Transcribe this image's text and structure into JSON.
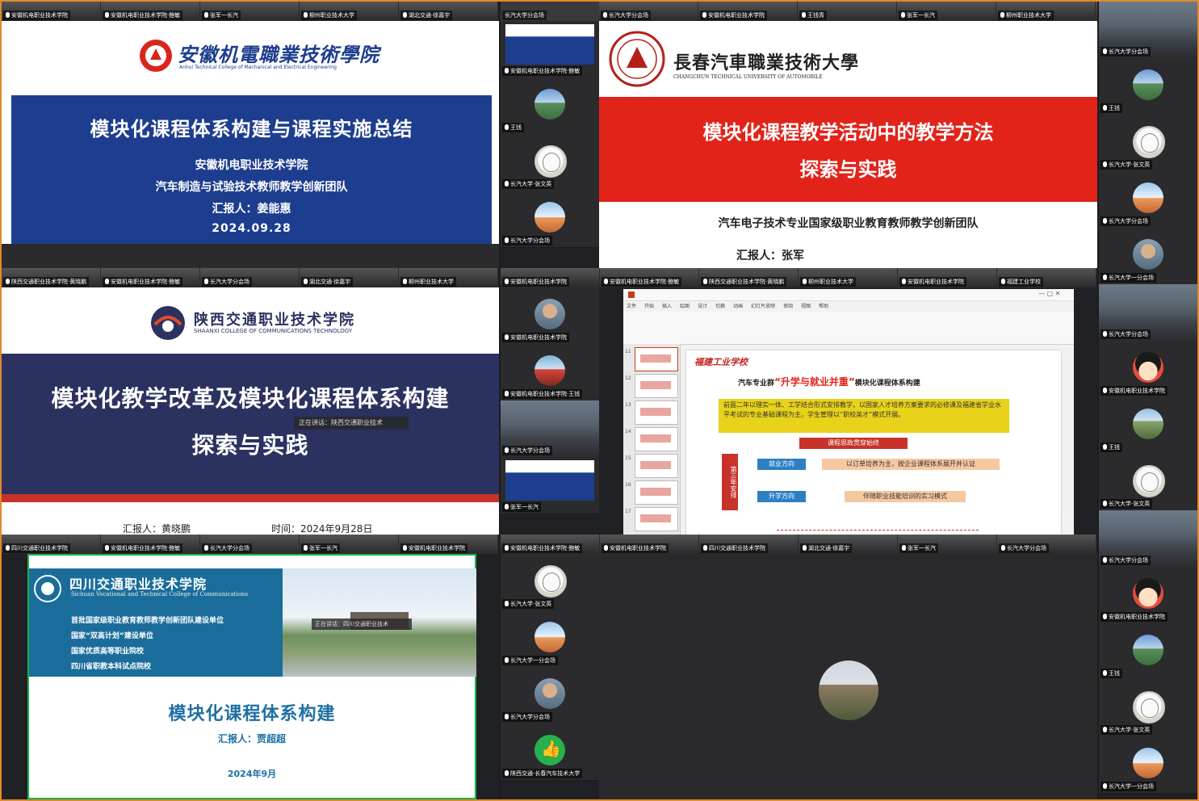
{
  "colors": {
    "frame_border": "#e08a2e",
    "meeting_bg": "#1d1d1f",
    "active_speaker": "#19b34a",
    "anhui_blue": "#1d3d8e",
    "changchun_red": "#e2231a",
    "shaanxi_navy": "#2b3260",
    "sichuan_blue": "#1a6d9b",
    "sichuan_title": "#1f6fa3"
  },
  "top_strip_1": [
    {
      "name": "安徽机电职业技术学院"
    },
    {
      "name": "安徽机电职业技术学院·鲍敏"
    },
    {
      "name": "张军一长汽"
    },
    {
      "name": "柳州职业技术大学"
    },
    {
      "name": "湖北交通·徐嘉宇"
    }
  ],
  "top_strip_2": [
    {
      "name": "长汽大学分会场"
    },
    {
      "name": "安徽机电职业技术学院"
    },
    {
      "name": "王钱青"
    },
    {
      "name": "张军一长汽"
    },
    {
      "name": "柳州职业技术大学"
    },
    {
      "name": "安徽机电职业技术学院"
    }
  ],
  "strip_row2_left": [
    {
      "name": "陕西交通职业技术学院·黄晓鹏"
    },
    {
      "name": "安徽机电职业技术学院·鲍敏"
    },
    {
      "name": "长汽大学分会场"
    },
    {
      "name": "湖北交通·徐嘉宇"
    },
    {
      "name": "柳州职业技术大学"
    }
  ],
  "strip_row2_right": [
    {
      "name": "安徽机电职业技术学院"
    },
    {
      "name": "安徽机电职业技术学院·鲍敏"
    },
    {
      "name": "陕西交通职业技术学院·黄晓鹏"
    },
    {
      "name": "柳州职业技术大学"
    },
    {
      "name": "安徽机电职业技术学院"
    },
    {
      "name": "福建工业学校"
    }
  ],
  "strip_row3_left": [
    {
      "name": "四川交通职业技术学院"
    },
    {
      "name": "安徽机电职业技术学院·鲍敏"
    },
    {
      "name": "长汽大学分会场"
    },
    {
      "name": "张军一长汽"
    },
    {
      "name": "安徽机电职业技术学院"
    }
  ],
  "strip_row3_right": [
    {
      "name": "安徽机电职业技术学院·鲍敏"
    },
    {
      "name": "安徽机电职业技术学院"
    },
    {
      "name": "四川交通职业技术学院"
    },
    {
      "name": "湖北交通·徐嘉宇"
    },
    {
      "name": "张军一长汽"
    },
    {
      "name": "长汽大学分会场"
    }
  ],
  "side_mid": [
    {
      "name": "安徽机电职业技术学院·鲍敏",
      "avatar": "slide"
    },
    {
      "name": "王钱",
      "avatar": "nature"
    },
    {
      "name": "长汽大学·张文英",
      "avatar": "sketch"
    },
    {
      "name": "长汽大学分会场",
      "avatar": "sky"
    },
    {
      "name": "安徽机电职业技术学院",
      "avatar": "person"
    },
    {
      "name": "安徽机电职业技术学院·王钱",
      "avatar": "red"
    },
    {
      "name": "长汽大学分会场",
      "avatar": "photo"
    },
    {
      "name": "张军一长汽",
      "avatar": "slide"
    },
    {
      "name": "安徽机电职业技术学院",
      "avatar": "cartoon"
    },
    {
      "name": "王钱",
      "avatar": "field"
    },
    {
      "name": "长汽大学·张文英",
      "avatar": "sketch"
    },
    {
      "name": "长汽大学一分会场",
      "avatar": "sky"
    },
    {
      "name": "长汽大学分会场",
      "avatar": "person"
    },
    {
      "name": "陕西交通·长春汽车技术大学",
      "avatar": "thumb"
    }
  ],
  "side_right": [
    {
      "name": "长汽大学分会场",
      "avatar": "photo"
    },
    {
      "name": "王钱",
      "avatar": "nature"
    },
    {
      "name": "长汽大学·张文英",
      "avatar": "sketch"
    },
    {
      "name": "长汽大学分会场",
      "avatar": "sky"
    },
    {
      "name": "长汽大学一分会场",
      "avatar": "person"
    },
    {
      "name": "长汽大学分会场",
      "avatar": "photo"
    },
    {
      "name": "安徽机电职业技术学院",
      "avatar": "cartoon"
    },
    {
      "name": "王钱",
      "avatar": "field"
    },
    {
      "name": "长汽大学·张文英",
      "avatar": "sketch"
    },
    {
      "name": "长汽大学分会场",
      "avatar": "photo"
    },
    {
      "name": "安徽机电职业技术学院",
      "avatar": "cartoon"
    },
    {
      "name": "王钱",
      "avatar": "nature"
    },
    {
      "name": "长汽大学·张文英",
      "avatar": "sketch"
    },
    {
      "name": "长汽大学一分会场",
      "avatar": "sky"
    }
  ],
  "anhui": {
    "school_cn": "安徽机電職業技術學院",
    "school_en": "Anhui Technical College of Mechanical and Electrical Engineering",
    "title": "模块化课程体系构建与课程实施总结",
    "line1": "安徽机电职业技术学院",
    "line2": "汽车制造与试验技术教师教学创新团队",
    "reporter": "汇报人：姜能惠",
    "date": "2024.09.28"
  },
  "changchun": {
    "school_cn": "長春汽車職業技術大學",
    "school_en": "CHANGCHUN TECHNICAL UNIVERSITY OF AUTOMOBILE",
    "title_line1": "模块化课程教学活动中的教学方法",
    "title_line2": "探索与实践",
    "team": "汽车电子技术专业国家级职业教育教师教学创新团队",
    "reporter": "汇报人：张军"
  },
  "shaanxi": {
    "school_cn": "陕西交通职业技术学院",
    "school_en": "SHAANXI COLLEGE OF COMMUNICATIONS TECHNOLOGY",
    "title_line1": "模块化教学改革及模块化课程体系构建",
    "title_line2": "探索与实践",
    "overlay": "正在讲话：陕西交通职业技术",
    "reporter": "汇报人：黄晓鹏",
    "time": "时间：2024年9月28日"
  },
  "fujian": {
    "brand": "福建工业学校",
    "heading_pre": "汽车专业群",
    "heading_highlight": "“升学与就业并重”",
    "heading_post": "模块化课程体系构建",
    "para": "前面二年以理实一体、工学结合形式安排教学，以国家人才培养方案要求的必修课及福建省学业水平考试的专业基础课程为主。学生管理以“职校英才”模式开展。",
    "thread": "课程思政贯穿始终",
    "vertical": "第三年安排",
    "path1": "就业方向",
    "desc1": "以订单培养为主，按企业课程体系展开并认证",
    "path2": "升学方向",
    "desc2": "伴随职业技能培训的实习模式",
    "ribbon_tabs": [
      "文件",
      "开始",
      "插入",
      "绘图",
      "设计",
      "切换",
      "动画",
      "幻灯片放映",
      "审阅",
      "视图",
      "帮助"
    ],
    "thumb_numbers": [
      "11",
      "12",
      "13",
      "14",
      "15",
      "16",
      "17"
    ]
  },
  "sichuan": {
    "school_cn": "四川交通职业技术学院",
    "school_en": "Sichuan Vocational and Technical College of Communications",
    "bullets": [
      "首批国家级职业教育教师教学创新团队建设单位",
      "国家“双高计划”建设单位",
      "国家优质高等职业院校",
      "四川省职教本科试点院校"
    ],
    "overlay": "正在讲话：四川交通职业技术",
    "title": "模块化课程体系构建",
    "reporter": "汇报人：贾超超",
    "date": "2024年9月"
  }
}
